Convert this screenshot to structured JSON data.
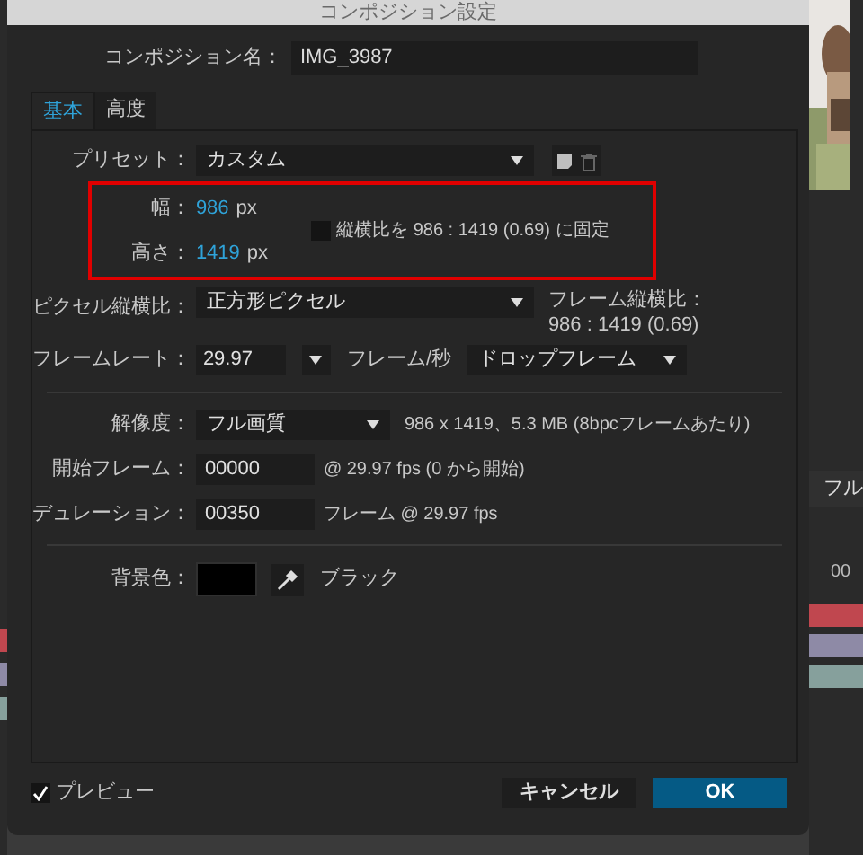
{
  "window": {
    "title": "コンポジション設定"
  },
  "composition_name": {
    "label": "コンポジション名：",
    "value": "IMG_3987"
  },
  "tabs": [
    {
      "label": "基本",
      "selected": true
    },
    {
      "label": "高度",
      "selected": false
    }
  ],
  "preset": {
    "label": "プリセット：",
    "value": "カスタム"
  },
  "width": {
    "label": "幅：",
    "value": "986",
    "unit": "px"
  },
  "height": {
    "label": "高さ：",
    "value": "1419",
    "unit": "px"
  },
  "lock_aspect": {
    "checked": false,
    "label": "縦横比を 986 : 1419 (0.69) に固定"
  },
  "pixel_aspect": {
    "label": "ピクセル縦横比：",
    "value": "正方形ピクセル"
  },
  "frame_aspect": {
    "label": "フレーム縦横比：",
    "value": "986 : 1419 (0.69)"
  },
  "frame_rate": {
    "label": "フレームレート：",
    "value": "29.97",
    "unit": "フレーム/秒",
    "mode": "ドロップフレーム"
  },
  "resolution": {
    "label": "解像度：",
    "value": "フル画質",
    "info": "986 x 1419、5.3 MB (8bpcフレームあたり)"
  },
  "start_frame": {
    "label": "開始フレーム：",
    "value": "00000",
    "note": "@ 29.97 fps (0 から開始)"
  },
  "duration": {
    "label": "デュレーション：",
    "value": "00350",
    "note": "フレーム @ 29.97 fps"
  },
  "background_color": {
    "label": "背景色：",
    "color": "#000000",
    "name": "ブラック"
  },
  "preview": {
    "checked": true,
    "label": "プレビュー"
  },
  "buttons": [
    {
      "label": "キャンセル",
      "kind": "secondary"
    },
    {
      "label": "OK",
      "kind": "primary"
    }
  ],
  "background_panel": {
    "resolution_text": "フル",
    "time_text": "00"
  },
  "layers": [
    {
      "color": "#c0474f"
    },
    {
      "color": "#8e8aa6"
    },
    {
      "color": "#86a09c"
    }
  ]
}
